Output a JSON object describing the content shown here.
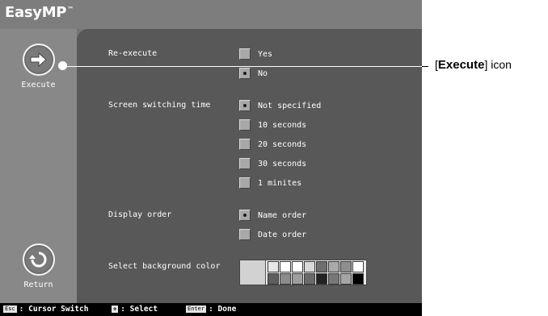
{
  "app": {
    "logo_text": "EasyMP",
    "logo_tm": "™"
  },
  "sidebar": {
    "execute_label": "Execute",
    "return_label": "Return"
  },
  "settings": {
    "reexecute": {
      "label": "Re-execute",
      "options": [
        {
          "text": "Yes",
          "selected": false
        },
        {
          "text": "No",
          "selected": true
        }
      ]
    },
    "switching": {
      "label": "Screen switching time",
      "options": [
        {
          "text": "Not specified",
          "selected": true
        },
        {
          "text": "10 seconds",
          "selected": false
        },
        {
          "text": "20 seconds",
          "selected": false
        },
        {
          "text": "30 seconds",
          "selected": false
        },
        {
          "text": "1 minites",
          "selected": false
        }
      ]
    },
    "display_order": {
      "label": "Display order",
      "options": [
        {
          "text": "Name order",
          "selected": true
        },
        {
          "text": "Date order",
          "selected": false
        }
      ]
    },
    "background": {
      "label": "Select background color",
      "selected_color": "#d2d2d2",
      "swatches_top": [
        "#e6e6e6",
        "#ffffff",
        "#ffffff",
        "#d9d9d9",
        "#6e6e6e",
        "#a9a9a9",
        "#8e8e8e",
        "#ffffff"
      ],
      "swatches_bottom": [
        "#5e5e5e",
        "#8c8c8c",
        "#9e9e9e",
        "#6a6a6a",
        "#222222",
        "#777777",
        "#a5a5a5",
        "#000000"
      ]
    }
  },
  "footer": {
    "esc_key": "Esc",
    "esc_text": ": Cursor Switch",
    "arrow_text": ": Select",
    "enter_key": "Enter",
    "enter_text": ": Done"
  },
  "callout": {
    "prefix": "[",
    "bold": "Execute",
    "suffix": "] icon"
  },
  "colors": {
    "screen_bg": "#757575",
    "panel_bg": "#585858",
    "sidebar_bg": "#888888"
  }
}
